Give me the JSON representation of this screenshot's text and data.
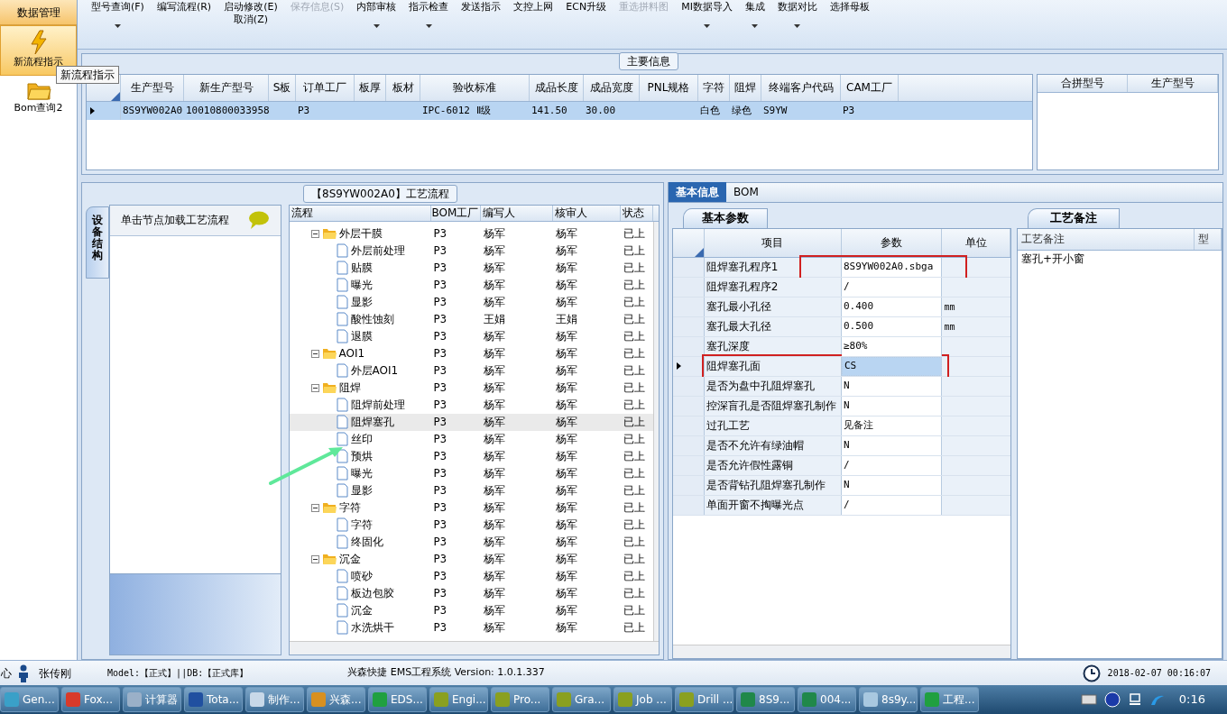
{
  "sidebar": {
    "title": "数据管理",
    "items": [
      {
        "label": "新流程指示",
        "selected": true,
        "kind": "lightning"
      },
      {
        "label": "Bom查询2",
        "selected": false,
        "kind": "folder"
      }
    ],
    "tooltip": "新流程指示"
  },
  "toolbar": {
    "buttons": [
      {
        "label": "型号查询(F)",
        "disabled": false,
        "dropdown": true
      },
      {
        "label": "编写流程(R)",
        "disabled": false,
        "dropdown": false
      },
      {
        "label": "启动修改(E)",
        "second_label": "取消(Z)",
        "disabled": false,
        "dropdown": false
      },
      {
        "label": "保存信息(S)",
        "disabled": true,
        "dropdown": false
      },
      {
        "label": "内部审核",
        "disabled": false,
        "dropdown": true
      },
      {
        "label": "指示检查",
        "disabled": false,
        "dropdown": true
      },
      {
        "label": "发送指示",
        "disabled": false,
        "dropdown": false
      },
      {
        "label": "文控上网",
        "disabled": false,
        "dropdown": false
      },
      {
        "label": "ECN升级",
        "disabled": false,
        "dropdown": false
      },
      {
        "label": "重选拼料图",
        "disabled": true,
        "dropdown": false
      },
      {
        "label": "MI数据导入",
        "disabled": false,
        "dropdown": true
      },
      {
        "label": "集成",
        "disabled": false,
        "dropdown": true
      },
      {
        "label": "数据对比",
        "disabled": false,
        "dropdown": true
      },
      {
        "label": "选择母板",
        "disabled": false,
        "dropdown": false
      }
    ]
  },
  "main_info": {
    "title": "主要信息",
    "columns": [
      "生产型号",
      "新生产型号",
      "S板",
      "订单工厂",
      "板厚",
      "板材",
      "验收标准",
      "成品长度",
      "成品宽度",
      "PNL规格",
      "字符",
      "阻焊",
      "终端客户代码",
      "CAM工厂"
    ],
    "rows": [
      {
        "selected": true,
        "cells": [
          "8S9YW002A0",
          "10010800033958",
          "",
          "P3",
          "",
          "",
          "IPC-6012 Ⅱ级",
          "141.50",
          "30.00",
          "",
          "白色",
          "绿色",
          "S9YW",
          "P3"
        ]
      }
    ],
    "merge_columns": [
      "合拼型号",
      "生产型号"
    ]
  },
  "process_panel": {
    "title": "【8S9YW002A0】工艺流程",
    "side_tab": "设备结构",
    "hint": "单击节点加载工艺流程",
    "columns": [
      "流程",
      "BOM工厂",
      "编写人",
      "核审人",
      "状态"
    ],
    "tree": [
      {
        "label": "外层干膜",
        "bom": "P3",
        "writer": "杨军",
        "reviewer": "杨军",
        "status": "已上",
        "expanded": true,
        "selected": false,
        "children": [
          {
            "label": "外层前处理",
            "bom": "P3",
            "writer": "杨军",
            "reviewer": "杨军",
            "status": "已上",
            "selected": false
          },
          {
            "label": "贴膜",
            "bom": "P3",
            "writer": "杨军",
            "reviewer": "杨军",
            "status": "已上",
            "selected": false
          },
          {
            "label": "曝光",
            "bom": "P3",
            "writer": "杨军",
            "reviewer": "杨军",
            "status": "已上",
            "selected": false
          },
          {
            "label": "显影",
            "bom": "P3",
            "writer": "杨军",
            "reviewer": "杨军",
            "status": "已上",
            "selected": false
          },
          {
            "label": "酸性蚀刻",
            "bom": "P3",
            "writer": "王娟",
            "reviewer": "王娟",
            "status": "已上",
            "selected": false
          },
          {
            "label": "退膜",
            "bom": "P3",
            "writer": "杨军",
            "reviewer": "杨军",
            "status": "已上",
            "selected": false
          }
        ]
      },
      {
        "label": "AOI1",
        "bom": "P3",
        "writer": "杨军",
        "reviewer": "杨军",
        "status": "已上",
        "expanded": true,
        "selected": false,
        "children": [
          {
            "label": "外层AOI1",
            "bom": "P3",
            "writer": "杨军",
            "reviewer": "杨军",
            "status": "已上",
            "selected": false
          }
        ]
      },
      {
        "label": "阻焊",
        "bom": "P3",
        "writer": "杨军",
        "reviewer": "杨军",
        "status": "已上",
        "expanded": true,
        "selected": false,
        "children": [
          {
            "label": "阻焊前处理",
            "bom": "P3",
            "writer": "杨军",
            "reviewer": "杨军",
            "status": "已上",
            "selected": false
          },
          {
            "label": "阻焊塞孔",
            "bom": "P3",
            "writer": "杨军",
            "reviewer": "杨军",
            "status": "已上",
            "selected": true
          },
          {
            "label": "丝印",
            "bom": "P3",
            "writer": "杨军",
            "reviewer": "杨军",
            "status": "已上",
            "selected": false
          },
          {
            "label": "预烘",
            "bom": "P3",
            "writer": "杨军",
            "reviewer": "杨军",
            "status": "已上",
            "selected": false
          },
          {
            "label": "曝光",
            "bom": "P3",
            "writer": "杨军",
            "reviewer": "杨军",
            "status": "已上",
            "selected": false
          },
          {
            "label": "显影",
            "bom": "P3",
            "writer": "杨军",
            "reviewer": "杨军",
            "status": "已上",
            "selected": false
          }
        ]
      },
      {
        "label": "字符",
        "bom": "P3",
        "writer": "杨军",
        "reviewer": "杨军",
        "status": "已上",
        "expanded": true,
        "selected": false,
        "children": [
          {
            "label": "字符",
            "bom": "P3",
            "writer": "杨军",
            "reviewer": "杨军",
            "status": "已上",
            "selected": false
          },
          {
            "label": "终固化",
            "bom": "P3",
            "writer": "杨军",
            "reviewer": "杨军",
            "status": "已上",
            "selected": false
          }
        ]
      },
      {
        "label": "沉金",
        "bom": "P3",
        "writer": "杨军",
        "reviewer": "杨军",
        "status": "已上",
        "expanded": true,
        "selected": false,
        "children": [
          {
            "label": "喷砂",
            "bom": "P3",
            "writer": "杨军",
            "reviewer": "杨军",
            "status": "已上",
            "selected": false
          },
          {
            "label": "板边包胶",
            "bom": "P3",
            "writer": "杨军",
            "reviewer": "杨军",
            "status": "已上",
            "selected": false
          },
          {
            "label": "沉金",
            "bom": "P3",
            "writer": "杨军",
            "reviewer": "杨军",
            "status": "已上",
            "selected": false
          },
          {
            "label": "水洗烘干",
            "bom": "P3",
            "writer": "杨军",
            "reviewer": "杨军",
            "status": "已上",
            "selected": false
          }
        ]
      }
    ]
  },
  "detail_tabs": [
    {
      "label": "基本信息",
      "selected": true
    },
    {
      "label": "BOM",
      "selected": false
    }
  ],
  "params_panel": {
    "tab": "基本参数",
    "columns": [
      "项目",
      "参数",
      "单位"
    ],
    "rows": [
      {
        "item": "阻焊塞孔程序1",
        "value": "8S9YW002A0.sbga",
        "unit": "",
        "selected": false,
        "marked": true
      },
      {
        "item": "阻焊塞孔程序2",
        "value": "/",
        "unit": "",
        "selected": false,
        "marked": false
      },
      {
        "item": "塞孔最小孔径",
        "value": "0.400",
        "unit": "mm",
        "selected": false,
        "marked": false
      },
      {
        "item": "塞孔最大孔径",
        "value": "0.500",
        "unit": "mm",
        "selected": false,
        "marked": false
      },
      {
        "item": "塞孔深度",
        "value": "≥80%",
        "unit": "",
        "selected": false,
        "marked": false
      },
      {
        "item": "阻焊塞孔面",
        "value": "CS",
        "unit": "",
        "selected": true,
        "marked": true
      },
      {
        "item": "是否为盘中孔阻焊塞孔",
        "value": "N",
        "unit": "",
        "selected": false,
        "marked": false
      },
      {
        "item": "控深盲孔是否阻焊塞孔制作",
        "value": "N",
        "unit": "",
        "selected": false,
        "marked": false
      },
      {
        "item": "过孔工艺",
        "value": "见备注",
        "unit": "",
        "selected": false,
        "marked": false
      },
      {
        "item": "是否不允许有绿油帽",
        "value": "N",
        "unit": "",
        "selected": false,
        "marked": false
      },
      {
        "item": "是否允许假性露铜",
        "value": "/",
        "unit": "",
        "selected": false,
        "marked": false
      },
      {
        "item": "是否背钻孔阻焊塞孔制作",
        "value": "N",
        "unit": "",
        "selected": false,
        "marked": false
      },
      {
        "item": "单面开窗不掏曝光点",
        "value": "/",
        "unit": "",
        "selected": false,
        "marked": false
      }
    ]
  },
  "notes_panel": {
    "tab": "工艺备注",
    "columns": [
      "工艺备注",
      "型"
    ],
    "rows": [
      "塞孔+开小窗"
    ]
  },
  "status_bar": {
    "cut_text": "心",
    "user": "张传刚",
    "db": "Model:【正式】||DB:【正式库】",
    "app": "兴森快捷 EMS工程系统 Version: 1.0.1.337",
    "datetime": "2018-02-07 00:16:07"
  },
  "taskbar": {
    "items": [
      {
        "label": "Gen...",
        "color": "#3aa0c8"
      },
      {
        "label": "Fox...",
        "color": "#d83a2a"
      },
      {
        "label": "计算器",
        "color": "#9ab0c8"
      },
      {
        "label": "Tota...",
        "color": "#2050a0"
      },
      {
        "label": "制作...",
        "color": "#c8d8e8"
      },
      {
        "label": "兴森...",
        "color": "#d89020"
      },
      {
        "label": "EDS...",
        "color": "#20a040"
      },
      {
        "label": "Engi...",
        "color": "#8aa020"
      },
      {
        "label": "Pro...",
        "color": "#8aa020"
      },
      {
        "label": "Gra...",
        "color": "#8aa020"
      },
      {
        "label": "Job ...",
        "color": "#8aa020"
      },
      {
        "label": "Drill ...",
        "color": "#8aa020"
      },
      {
        "label": "8S9...",
        "color": "#20884a"
      },
      {
        "label": "004...",
        "color": "#20884a"
      },
      {
        "label": "8s9y...",
        "color": "#a8c8e0"
      },
      {
        "label": "工程...",
        "color": "#20a040"
      }
    ],
    "clock": "0:16"
  }
}
